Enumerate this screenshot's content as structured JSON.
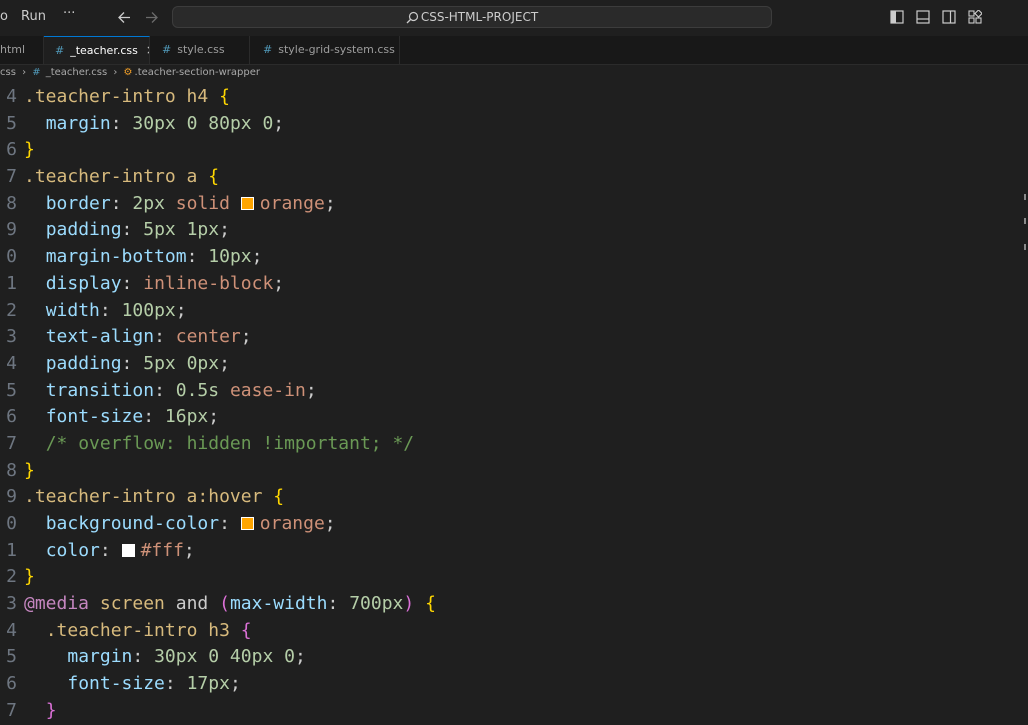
{
  "titlebar": {
    "menu_partial": "o",
    "menu_run": "Run",
    "menu_more": "···",
    "command_center": "CSS-HTML-PROJECT"
  },
  "tabs": [
    {
      "label": "html"
    },
    {
      "label": "_teacher.css",
      "close": "×"
    },
    {
      "label": "style.css"
    },
    {
      "label": "style-grid-system.css"
    }
  ],
  "breadcrumb": {
    "root": "css",
    "file": "_teacher.css",
    "symbol": ".teacher-section-wrapper"
  },
  "editor": {
    "line_numbers": [
      "4",
      "5",
      "6",
      "7",
      "8",
      "9",
      "0",
      "1",
      "2",
      "3",
      "4",
      "5",
      "6",
      "7",
      "8",
      "9",
      "0",
      "1",
      "2",
      "3",
      "4",
      "5",
      "6",
      "7"
    ],
    "colors": {
      "orange": "#ffa500",
      "white": "#ffffff"
    }
  }
}
